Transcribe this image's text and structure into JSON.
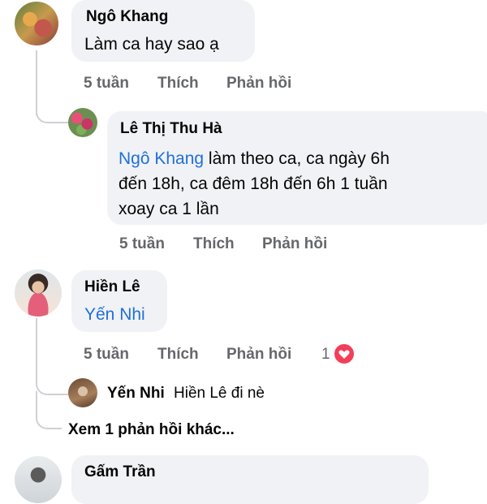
{
  "comments": [
    {
      "author": "Ngô Khang",
      "text": "Làm ca hay sao ạ",
      "time": "5 tuần",
      "like_label": "Thích",
      "reply_label": "Phản hồi"
    },
    {
      "author": "Lê Thị Thu Hà",
      "mention": "Ngô Khang",
      "text_line1": " làm theo ca, ca ngày 6h",
      "text_line2": "đến 18h, ca đêm 18h đến 6h 1 tuần",
      "text_line3": "xoay ca 1 lần",
      "time": "5 tuần",
      "like_label": "Thích",
      "reply_label": "Phản hồi"
    },
    {
      "author": "Hiền Lê",
      "mention": "Yến Nhi",
      "time": "5 tuần",
      "like_label": "Thích",
      "reply_label": "Phản hồi",
      "reaction_count": "1",
      "reaction_icon": "heart-icon"
    },
    {
      "author": "Yến Nhi",
      "text": "Hiền Lê đi nè"
    },
    {
      "author": "Gấm Trần"
    }
  ],
  "more_replies": "Xem 1 phản hồi khác...",
  "colors": {
    "bubble": "#f0f2f5",
    "mention": "#216fdb",
    "meta": "#65676b",
    "heart": "#f33e58"
  }
}
